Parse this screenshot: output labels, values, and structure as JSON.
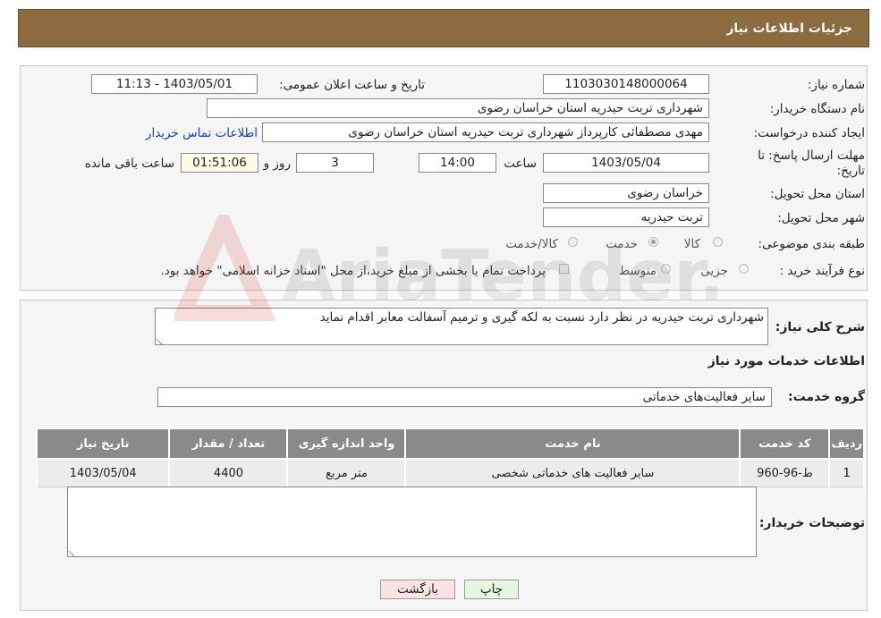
{
  "header": {
    "title": "جزئیات اطلاعات نیاز"
  },
  "form": {
    "need_number_label": "شماره نیاز:",
    "need_number": "1103030148000064",
    "announce_label": "تاریخ و ساعت اعلان عمومی:",
    "announce_value": "1403/05/01 - 11:13",
    "buyer_org_label": "نام دستگاه خریدار:",
    "buyer_org": "شهرداری تربت حیدریه استان خراسان رضوی",
    "creator_label": "ایجاد کننده درخواست:",
    "creator": "مهدی مصطفائی کارپرداز شهرداری تربت حیدریه استان خراسان رضوی",
    "contact_link": "اطلاعات تماس خریدار",
    "deadline_label": "مهلت ارسال پاسخ: تا تاریخ:",
    "deadline_date": "1403/05/04",
    "time_label": "ساعت",
    "deadline_time": "14:00",
    "days_value": "3",
    "days_label": "روز و",
    "remaining_time": "01:51:06",
    "remaining_label": "ساعت باقی مانده",
    "province_label": "استان محل تحویل:",
    "province": "خراسان رضوی",
    "city_label": "شهر محل تحویل:",
    "city": "تربت حیدریه",
    "category_label": "طبقه بندی موضوعی:",
    "category_options": [
      "کالا",
      "خدمت",
      "کالا/خدمت"
    ],
    "category_selected": "خدمت",
    "process_label": "نوع فرآیند خرید :",
    "process_options": [
      "جزیی",
      "متوسط"
    ],
    "process_note": "پرداخت تمام یا بخشی از مبلغ خرید،از محل \"اسناد خزانه اسلامی\" خواهد بود."
  },
  "description": {
    "label": "شرح کلی نیاز:",
    "value": "شهرداری تربت حیدریه در نظر دارد نسبت به لکه گیری و ترمیم آسفالت معابر اقدام نماید"
  },
  "services": {
    "section_title": "اطلاعات خدمات مورد نیاز",
    "group_label": "گروه خدمت:",
    "group_value": "سایر فعالیت‌های خدماتی",
    "table": {
      "headers": [
        "ردیف",
        "کد خدمت",
        "نام خدمت",
        "واحد اندازه گیری",
        "تعداد / مقدار",
        "تاریخ نیاز"
      ],
      "rows": [
        [
          "1",
          "ط-96-960",
          "سایر فعالیت های خدماتی شخصی",
          "متر مربع",
          "4400",
          "1403/05/04"
        ]
      ]
    }
  },
  "buyer_notes": {
    "label": "توضیحات خریدار:",
    "value": ""
  },
  "buttons": {
    "print": "چاپ",
    "back": "بازگشت"
  },
  "watermark": {
    "text": "AriaTender.neT"
  },
  "colors": {
    "header_bg": "#8b6b3f",
    "table_header_bg": "#8a8a8a",
    "link": "#1a3fbf",
    "back_button_bg": "#fbe3e3",
    "print_button_bg": "#e6f7e0"
  }
}
